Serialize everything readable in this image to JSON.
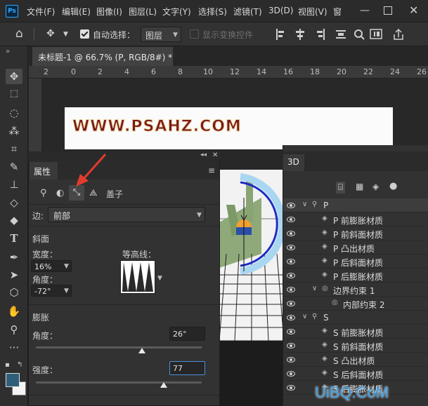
{
  "menubar": {
    "logo": "Ps",
    "items": [
      "文件(F)",
      "编辑(E)",
      "图像(I)",
      "图层(L)",
      "文字(Y)",
      "选择(S)",
      "滤镜(T)",
      "3D(D)",
      "视图(V)",
      "窗"
    ]
  },
  "options": {
    "auto_select_label": "自动选择：",
    "auto_select_checked": true,
    "layer_target": "图层",
    "transform_label": "显示变换控件"
  },
  "document": {
    "tab_title": "未标题-1 @ 66.7% (P, RGB/8#) *",
    "ruler_marks": [
      "2",
      "0",
      "2",
      "4",
      "6",
      "8",
      "10",
      "12",
      "14",
      "16",
      "18",
      "20",
      "22",
      "24",
      "26"
    ],
    "canvas_text": "WWW.PSAHZ.COM"
  },
  "properties": {
    "tab": "属性",
    "cap_label": "盖子",
    "edge_label": "边:",
    "edge_value": "前部",
    "bevel_heading": "斜面",
    "width_label": "宽度：",
    "width_value": "16%",
    "angle_label": "角度：",
    "angle_value": "-72°",
    "contour_label": "等高线：",
    "inflate_heading": "膨胀",
    "inflate_angle_label": "角度：",
    "inflate_angle_value": "26°",
    "strength_label": "强度：",
    "strength_value": "77",
    "inflate_angle_fraction": 0.64,
    "strength_fraction": 0.77
  },
  "panel3d": {
    "tab": "3D",
    "rows": [
      {
        "label": "P",
        "indent": 0,
        "icon": "mesh-icon",
        "expanded": true
      },
      {
        "label": "P 前膨胀材质",
        "indent": 1,
        "icon": "material-icon"
      },
      {
        "label": "P 前斜面材质",
        "indent": 1,
        "icon": "material-icon"
      },
      {
        "label": "P 凸出材质",
        "indent": 1,
        "icon": "material-icon"
      },
      {
        "label": "P 后斜面材质",
        "indent": 1,
        "icon": "material-icon"
      },
      {
        "label": "P 后膨胀材质",
        "indent": 1,
        "icon": "material-icon"
      },
      {
        "label": "边界约束 1",
        "indent": 1,
        "icon": "constraint-icon",
        "expanded": true
      },
      {
        "label": "内部约束 2",
        "indent": 2,
        "icon": "constraint-icon"
      },
      {
        "label": "S",
        "indent": 0,
        "icon": "mesh-icon",
        "expanded": true
      },
      {
        "label": "S 前膨胀材质",
        "indent": 1,
        "icon": "material-icon"
      },
      {
        "label": "S 前斜面材质",
        "indent": 1,
        "icon": "material-icon"
      },
      {
        "label": "S 凸出材质",
        "indent": 1,
        "icon": "material-icon"
      },
      {
        "label": "S 后斜面材质",
        "indent": 1,
        "icon": "material-icon"
      },
      {
        "label": "S 后膨胀材质",
        "indent": 1,
        "icon": "material-icon"
      }
    ]
  },
  "watermark": "UiBQ.CoM",
  "colors": {
    "accent_arrow": "#e23b2e",
    "canvas_text": "#7a1a1a",
    "watermark": "#3fa1e6"
  }
}
